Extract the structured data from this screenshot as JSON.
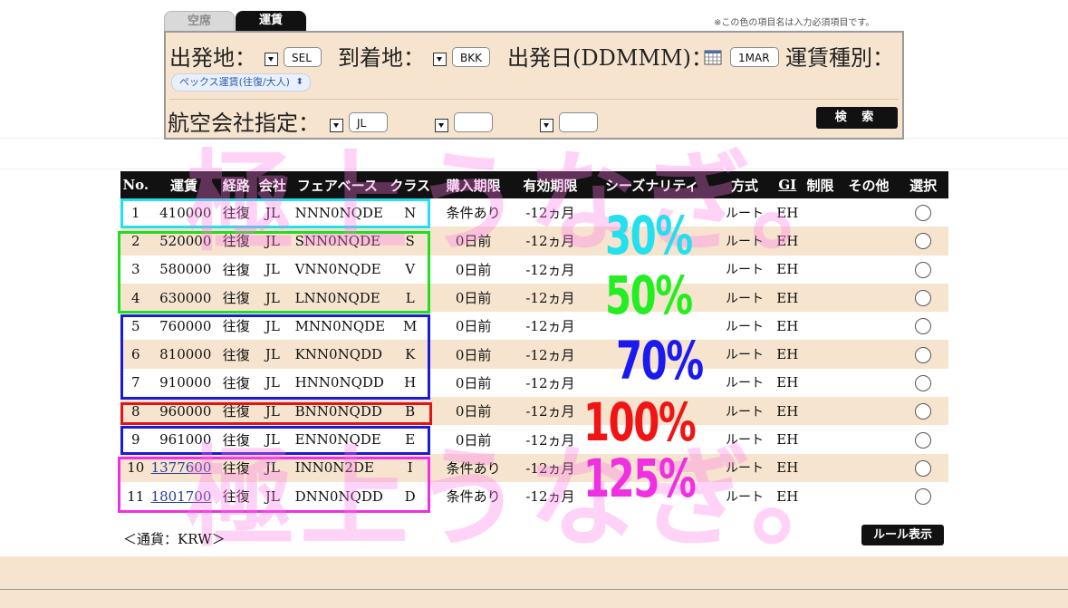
{
  "tabs": [
    {
      "label": "空席",
      "active": false
    },
    {
      "label": "運賃",
      "active": true
    }
  ],
  "required_note": "※この色の項目名は入力必須項目です。",
  "search": {
    "origin_label": "出発地：",
    "origin_value": "SEL",
    "destination_label": "到着地：",
    "destination_value": "BKK",
    "date_label": "出発日(DDMMM)：",
    "date_value": "1MAR",
    "fare_type_label": "運賃種別：",
    "fare_type_value": "ペックス運賃(往復/大人)",
    "airline_label": "航空会社指定：",
    "airline_values": [
      "JL",
      "",
      ""
    ],
    "search_button": "検 索"
  },
  "table": {
    "headers": [
      "No.",
      "運賃",
      "経路",
      "会社",
      "フェアベース",
      "クラス",
      "購入期限",
      "有効期限",
      "シーズナリティ",
      "方式",
      "GI",
      "制限",
      "その他",
      "選択"
    ],
    "rows": [
      {
        "no": "1",
        "fare": "410000",
        "route": "往復",
        "carrier": "JL",
        "basis": "NNN0NQDE",
        "class": "N",
        "purchase": "条件あり",
        "validity": "-12ヵ月",
        "season": "",
        "method": "ルート",
        "gi": "EH",
        "restrict": "",
        "other": "",
        "link": false
      },
      {
        "no": "2",
        "fare": "520000",
        "route": "往復",
        "carrier": "JL",
        "basis": "SNN0NQDE",
        "class": "S",
        "purchase": "0日前",
        "validity": "-12ヵ月",
        "season": "",
        "method": "ルート",
        "gi": "EH",
        "restrict": "",
        "other": "",
        "link": false
      },
      {
        "no": "3",
        "fare": "580000",
        "route": "往復",
        "carrier": "JL",
        "basis": "VNN0NQDE",
        "class": "V",
        "purchase": "0日前",
        "validity": "-12ヵ月",
        "season": "",
        "method": "ルート",
        "gi": "EH",
        "restrict": "",
        "other": "",
        "link": false
      },
      {
        "no": "4",
        "fare": "630000",
        "route": "往復",
        "carrier": "JL",
        "basis": "LNN0NQDE",
        "class": "L",
        "purchase": "0日前",
        "validity": "-12ヵ月",
        "season": "",
        "method": "ルート",
        "gi": "EH",
        "restrict": "",
        "other": "",
        "link": false
      },
      {
        "no": "5",
        "fare": "760000",
        "route": "往復",
        "carrier": "JL",
        "basis": "MNN0NQDE",
        "class": "M",
        "purchase": "0日前",
        "validity": "-12ヵ月",
        "season": "",
        "method": "ルート",
        "gi": "EH",
        "restrict": "",
        "other": "",
        "link": false
      },
      {
        "no": "6",
        "fare": "810000",
        "route": "往復",
        "carrier": "JL",
        "basis": "KNN0NQDD",
        "class": "K",
        "purchase": "0日前",
        "validity": "-12ヵ月",
        "season": "",
        "method": "ルート",
        "gi": "EH",
        "restrict": "",
        "other": "",
        "link": false
      },
      {
        "no": "7",
        "fare": "910000",
        "route": "往復",
        "carrier": "JL",
        "basis": "HNN0NQDD",
        "class": "H",
        "purchase": "0日前",
        "validity": "-12ヵ月",
        "season": "",
        "method": "ルート",
        "gi": "EH",
        "restrict": "",
        "other": "",
        "link": false
      },
      {
        "no": "8",
        "fare": "960000",
        "route": "往復",
        "carrier": "JL",
        "basis": "BNN0NQDD",
        "class": "B",
        "purchase": "0日前",
        "validity": "-12ヵ月",
        "season": "",
        "method": "ルート",
        "gi": "EH",
        "restrict": "",
        "other": "",
        "link": false
      },
      {
        "no": "9",
        "fare": "961000",
        "route": "往復",
        "carrier": "JL",
        "basis": "ENN0NQDE",
        "class": "E",
        "purchase": "0日前",
        "validity": "-12ヵ月",
        "season": "",
        "method": "ルート",
        "gi": "EH",
        "restrict": "",
        "other": "",
        "link": false
      },
      {
        "no": "10",
        "fare": "1377600",
        "route": "往復",
        "carrier": "JL",
        "basis": "INN0N2DE",
        "class": "I",
        "purchase": "条件あり",
        "validity": "-12ヵ月",
        "season": "",
        "method": "ルート",
        "gi": "EH",
        "restrict": "",
        "other": "",
        "link": true
      },
      {
        "no": "11",
        "fare": "1801700",
        "route": "往復",
        "carrier": "JL",
        "basis": "DNN0NQDD",
        "class": "D",
        "purchase": "条件あり",
        "validity": "-12ヵ月",
        "season": "",
        "method": "ルート",
        "gi": "EH",
        "restrict": "",
        "other": "",
        "link": true
      }
    ]
  },
  "currency_note": "＜通貨：KRW＞",
  "rule_button": "ルール表示",
  "annotations": {
    "percents": [
      {
        "text": "30%",
        "color": "#22e0ee"
      },
      {
        "text": "50%",
        "color": "#22ee22"
      },
      {
        "text": "70%",
        "color": "#1a1af0"
      },
      {
        "text": "100%",
        "color": "#f01414"
      },
      {
        "text": "125%",
        "color": "#f030e0"
      }
    ],
    "watermark_top": "極上うなぎ。",
    "watermark_bottom": "極上うなぎ。"
  },
  "colors": {
    "row_alt": "#f6e4cf",
    "header_bg": "#111111",
    "box_cyan": "#22e0ee",
    "box_green": "#22dd22",
    "box_blue": "#1a1ad8",
    "box_red": "#e01414",
    "box_magenta": "#f030e0"
  }
}
